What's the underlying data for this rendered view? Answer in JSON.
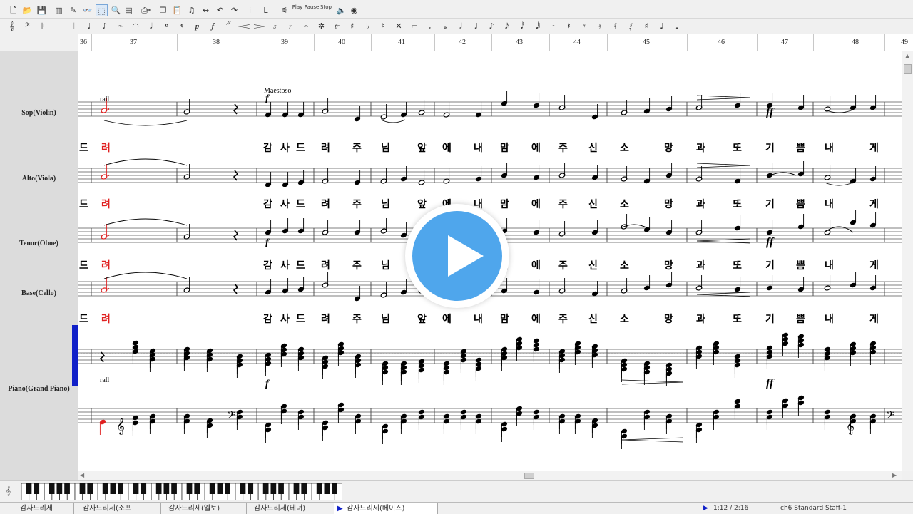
{
  "toolbar_top": {
    "buttons": [
      {
        "name": "new-file-icon",
        "glyph": "🗋"
      },
      {
        "name": "open-folder-icon",
        "glyph": "📂"
      },
      {
        "name": "save-icon",
        "glyph": "💾"
      },
      {
        "name": "book-icon",
        "glyph": "▥"
      },
      {
        "name": "pencil-icon",
        "glyph": "✎"
      },
      {
        "name": "glasses-icon",
        "glyph": "👓"
      },
      {
        "name": "select-tool-icon",
        "glyph": "⬚"
      },
      {
        "name": "zoom-icon",
        "glyph": "🔍"
      },
      {
        "name": "page-icon",
        "glyph": "▤"
      },
      {
        "name": "print-icon",
        "glyph": "⎙"
      },
      {
        "name": "cut-icon",
        "glyph": "✂"
      },
      {
        "name": "copy-icon",
        "glyph": "❐"
      },
      {
        "name": "paste-icon",
        "glyph": "📋"
      },
      {
        "name": "note-insert-icon",
        "glyph": "♫"
      },
      {
        "name": "arrow-icon",
        "glyph": "↔"
      },
      {
        "name": "undo-icon",
        "glyph": "↶"
      },
      {
        "name": "redo-icon",
        "glyph": "↷"
      },
      {
        "name": "info-icon",
        "glyph": "i"
      },
      {
        "name": "text-icon",
        "glyph": "L"
      },
      {
        "name": "mixer-icon",
        "glyph": "⚟"
      }
    ],
    "play_label": "Play",
    "pause_label": "Pause",
    "stop_label": "Stop",
    "speaker_glyph": "🔈",
    "metronome_glyph": "◉"
  },
  "toolbar_bottom": {
    "glyphs": [
      "𝄞",
      "𝄢",
      "𝄆",
      "𝄀",
      "𝄁",
      "♩",
      "♪",
      "𝄐",
      "◠",
      "𝅘𝅥",
      "𝄴",
      "𝄵",
      "𝆏",
      "𝆑",
      "𝄓",
      "𝆒",
      "𝆓",
      "𝆍",
      "𝆌",
      "𝄐",
      "✲",
      "𝆖",
      "♯",
      "♭",
      "♮",
      "✕",
      "⌐",
      "𝅗",
      "𝅝",
      "𝅗𝅥",
      "♩",
      "♪",
      "𝅘𝅥𝅯",
      "𝅘𝅥𝅰",
      "𝅘𝅥𝅱",
      "𝄼",
      "𝄽",
      "𝄾",
      "𝄿",
      "𝅀",
      "𝅁",
      "♯",
      "♩",
      "♩"
    ]
  },
  "ruler": {
    "measures": [
      "36",
      "37",
      "38",
      "39",
      "40",
      "41",
      "42",
      "43",
      "44",
      "45",
      "46",
      "47",
      "48",
      "49"
    ]
  },
  "tracks": [
    {
      "label": "Sop(Violin)"
    },
    {
      "label": "Alto(Viola)"
    },
    {
      "label": "Tenor(Oboe)"
    },
    {
      "label": "Base(Cello)"
    },
    {
      "label": "Piano(Grand Piano)"
    }
  ],
  "score": {
    "rall_label": "rall",
    "maestoso_label": "Maestoso",
    "f_label": "f",
    "ff_label": "ff",
    "red_lyric_start": "드",
    "red_lyric": "려",
    "lyrics": [
      "감",
      "사",
      "드",
      "려",
      "주",
      "님",
      "앞",
      "에",
      "내",
      "맘",
      "에",
      "주",
      "신",
      "소",
      "망",
      "과",
      "또",
      "기",
      "쁨",
      "내",
      "게"
    ],
    "accent_color": "#e02020"
  },
  "status": {
    "tabs": [
      "감사드리세",
      "감사드리세(소프",
      "감사드리세(엘토)",
      "감사드리세(테너)",
      "감사드리세(베이스)"
    ],
    "position": "1:12 / 2:16",
    "info": "ch6 Standard Staff-1"
  },
  "overlay": {
    "color": "#4fa6ec"
  }
}
